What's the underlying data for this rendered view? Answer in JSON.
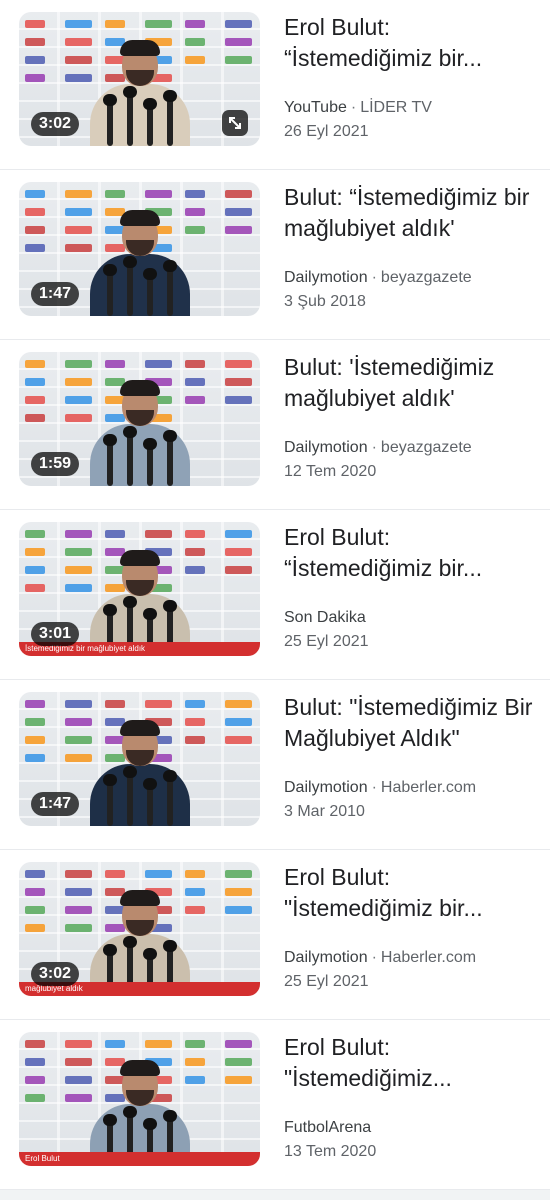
{
  "results": [
    {
      "title": "Erol Bulut: “İstemediğimiz bir...",
      "source": "YouTube",
      "channel": "LİDER TV",
      "date": "26 Eyl 2021",
      "duration": "3:02",
      "has_expand": true,
      "shirt": "#d9cdbb",
      "ticker": ""
    },
    {
      "title": "Bulut: “İstemediğimiz bir mağlubiyet aldık'",
      "source": "Dailymotion",
      "channel": "beyazgazete",
      "date": "3 Şub 2018",
      "duration": "1:47",
      "has_expand": false,
      "shirt": "#20314a",
      "ticker": ""
    },
    {
      "title": "Bulut: 'İstemediğimiz mağlubiyet aldık'",
      "source": "Dailymotion",
      "channel": "beyazgazete",
      "date": "12 Tem 2020",
      "duration": "1:59",
      "has_expand": false,
      "shirt": "#8fa2b6",
      "ticker": ""
    },
    {
      "title": "Erol Bulut: “İstemediğimiz bir...",
      "source": "Son Dakika",
      "channel": "",
      "date": "25 Eyl 2021",
      "duration": "3:01",
      "has_expand": false,
      "shirt": "#c9bfae",
      "ticker": "İstemediğimiz bir mağlubiyet aldık"
    },
    {
      "title": "Bulut: \"İstemediğimiz Bir Mağlubiyet Aldık\"",
      "source": "Dailymotion",
      "channel": "Haberler.com",
      "date": "3 Mar 2010",
      "duration": "1:47",
      "has_expand": false,
      "shirt": "#1e2f47",
      "ticker": ""
    },
    {
      "title": "Erol Bulut: \"İstemediğimiz bir...",
      "source": "Dailymotion",
      "channel": "Haberler.com",
      "date": "25 Eyl 2021",
      "duration": "3:02",
      "has_expand": false,
      "shirt": "#cbbfad",
      "ticker": "mağlubiyet aldık"
    },
    {
      "title": "Erol Bulut: \"İstemediğimiz...",
      "source": "FutbolArena",
      "channel": "",
      "date": "13 Tem 2020",
      "duration": "",
      "has_expand": false,
      "shirt": "#8da0b4",
      "ticker": "Erol Bulut"
    }
  ],
  "colors": {
    "separator": "#e8eaed",
    "duration_bg": "rgba(0,0,0,.72)",
    "text": "#202124",
    "secondary": "#5f6368"
  }
}
